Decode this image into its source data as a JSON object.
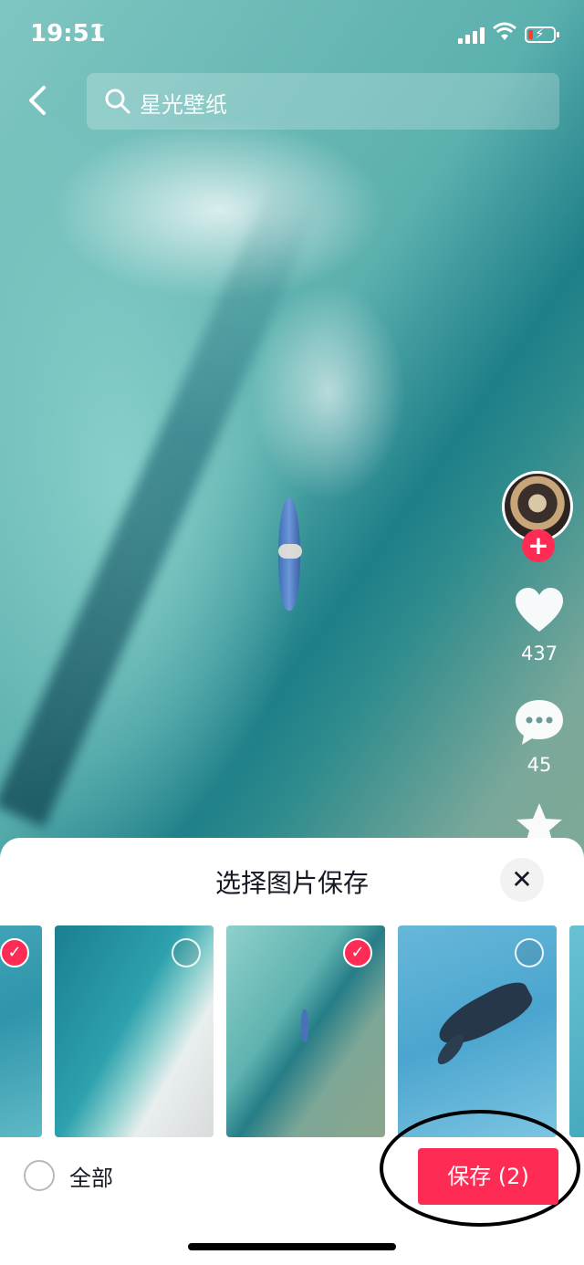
{
  "status_bar": {
    "time": "19:51"
  },
  "search": {
    "query": "星光壁纸"
  },
  "actions": {
    "like_count": "437",
    "comment_count": "45"
  },
  "sheet": {
    "title": "选择图片保存",
    "select_all_label": "全部",
    "save_label": "保存 (2)",
    "thumbnails": [
      {
        "name": "thumb-partial-left",
        "selected": true
      },
      {
        "name": "thumb-beach-waves",
        "selected": false
      },
      {
        "name": "thumb-surfer-channel",
        "selected": true
      },
      {
        "name": "thumb-whale",
        "selected": false
      },
      {
        "name": "thumb-partial-right",
        "selected": false
      }
    ]
  },
  "colors": {
    "accent": "#fe2c55",
    "sheet_background": "#ffffff",
    "text_primary": "#161823"
  },
  "icons": [
    "back-icon",
    "search-icon",
    "heart-icon",
    "comment-icon",
    "star-icon",
    "close-icon",
    "check-icon",
    "plus-icon",
    "moon-icon",
    "wifi-icon",
    "battery-icon",
    "signal-icon"
  ]
}
